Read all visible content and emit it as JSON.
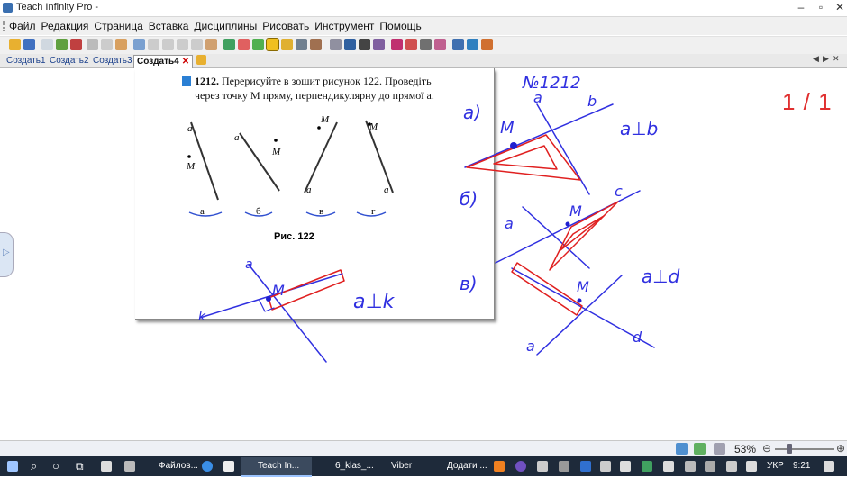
{
  "window": {
    "title": "Teach Infinity Pro -"
  },
  "menu": [
    "Файл",
    "Редакция",
    "Страница",
    "Вставка",
    "Дисциплины",
    "Рисовать",
    "Инструмент",
    "Помощь"
  ],
  "tabs": [
    {
      "label": "Создать1"
    },
    {
      "label": "Создать2"
    },
    {
      "label": "Создать3"
    },
    {
      "label": "Создать4"
    }
  ],
  "page_indicator": "1 / 1",
  "textbook": {
    "number": "1212.",
    "text_line1": "Перерисуйте в зошит рисунок 122. Проведіть",
    "text_line2": "через точку M пряму, перпендикулярну до прямої a.",
    "caption": "Рис. 122",
    "sub_labels": [
      "а",
      "б",
      "в",
      "г"
    ],
    "line_label": "a",
    "point_label": "M"
  },
  "handwriting": {
    "header": "№1212",
    "part_a": "а)",
    "part_b": "б)",
    "part_c": "в)",
    "label_a_line": "a",
    "label_b_line": "b",
    "label_c_line": "c",
    "label_d_line": "d",
    "label_k_line": "k",
    "point_M": "M",
    "rel1": "a⊥b",
    "rel2": "a⊥d",
    "rel3": "a⊥k"
  },
  "toolbar_icons": [
    "open-icon",
    "save-icon",
    "new-page-icon",
    "image-icon",
    "copy-page-icon",
    "export-icon",
    "print-icon",
    "hand-icon",
    "undo-icon",
    "redo-icon",
    "cut-icon",
    "copy-icon",
    "paste-icon",
    "delete-icon",
    "pointer-icon",
    "eraser-icon",
    "pen-icon",
    "highlighter-icon",
    "marker-icon",
    "brush-icon",
    "stamp-icon",
    "shape-icon",
    "line-icon",
    "text-icon",
    "stamp2-icon",
    "fx-icon",
    "abc-icon",
    "keyboard-icon",
    "flask-icon",
    "screen-icon",
    "record-icon",
    "tools-icon"
  ],
  "statusbar": {
    "zoom": "53%"
  },
  "taskbar": {
    "apps": [
      "Файлов...",
      "Teach In...",
      "6_klas_...",
      "Viber",
      "Додати ..."
    ],
    "lang": "УКР",
    "time": "9:21"
  },
  "colors": {
    "ink": "#3030e0",
    "red": "#e02020",
    "accent": "#1a3f8b"
  }
}
